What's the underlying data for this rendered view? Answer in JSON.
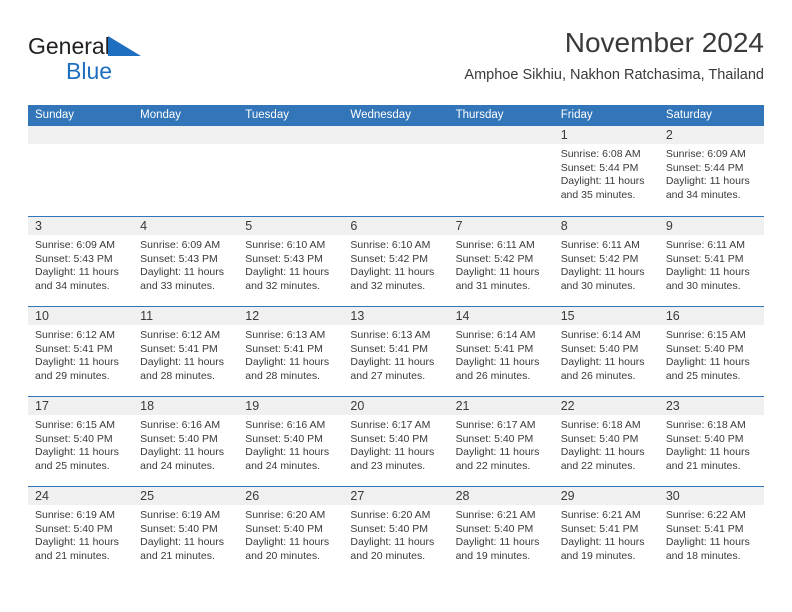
{
  "brand": {
    "name_part1": "General",
    "name_part2": "Blue",
    "flag_icon": "triangle-flag-icon"
  },
  "header": {
    "title": "November 2024",
    "subtitle": "Amphoe Sikhiu, Nakhon Ratchasima, Thailand"
  },
  "colors": {
    "header_blue": "#3275b8",
    "brand_blue": "#1f6fc0",
    "day_band_gray": "#f0f0f0",
    "text": "#3a3a3a"
  },
  "weekdays": [
    "Sunday",
    "Monday",
    "Tuesday",
    "Wednesday",
    "Thursday",
    "Friday",
    "Saturday"
  ],
  "weeks": [
    [
      {
        "day": "",
        "empty": true
      },
      {
        "day": "",
        "empty": true
      },
      {
        "day": "",
        "empty": true
      },
      {
        "day": "",
        "empty": true
      },
      {
        "day": "",
        "empty": true
      },
      {
        "day": "1",
        "sunrise": "Sunrise: 6:08 AM",
        "sunset": "Sunset: 5:44 PM",
        "daylight": "Daylight: 11 hours and 35 minutes."
      },
      {
        "day": "2",
        "sunrise": "Sunrise: 6:09 AM",
        "sunset": "Sunset: 5:44 PM",
        "daylight": "Daylight: 11 hours and 34 minutes."
      }
    ],
    [
      {
        "day": "3",
        "sunrise": "Sunrise: 6:09 AM",
        "sunset": "Sunset: 5:43 PM",
        "daylight": "Daylight: 11 hours and 34 minutes."
      },
      {
        "day": "4",
        "sunrise": "Sunrise: 6:09 AM",
        "sunset": "Sunset: 5:43 PM",
        "daylight": "Daylight: 11 hours and 33 minutes."
      },
      {
        "day": "5",
        "sunrise": "Sunrise: 6:10 AM",
        "sunset": "Sunset: 5:43 PM",
        "daylight": "Daylight: 11 hours and 32 minutes."
      },
      {
        "day": "6",
        "sunrise": "Sunrise: 6:10 AM",
        "sunset": "Sunset: 5:42 PM",
        "daylight": "Daylight: 11 hours and 32 minutes."
      },
      {
        "day": "7",
        "sunrise": "Sunrise: 6:11 AM",
        "sunset": "Sunset: 5:42 PM",
        "daylight": "Daylight: 11 hours and 31 minutes."
      },
      {
        "day": "8",
        "sunrise": "Sunrise: 6:11 AM",
        "sunset": "Sunset: 5:42 PM",
        "daylight": "Daylight: 11 hours and 30 minutes."
      },
      {
        "day": "9",
        "sunrise": "Sunrise: 6:11 AM",
        "sunset": "Sunset: 5:41 PM",
        "daylight": "Daylight: 11 hours and 30 minutes."
      }
    ],
    [
      {
        "day": "10",
        "sunrise": "Sunrise: 6:12 AM",
        "sunset": "Sunset: 5:41 PM",
        "daylight": "Daylight: 11 hours and 29 minutes."
      },
      {
        "day": "11",
        "sunrise": "Sunrise: 6:12 AM",
        "sunset": "Sunset: 5:41 PM",
        "daylight": "Daylight: 11 hours and 28 minutes."
      },
      {
        "day": "12",
        "sunrise": "Sunrise: 6:13 AM",
        "sunset": "Sunset: 5:41 PM",
        "daylight": "Daylight: 11 hours and 28 minutes."
      },
      {
        "day": "13",
        "sunrise": "Sunrise: 6:13 AM",
        "sunset": "Sunset: 5:41 PM",
        "daylight": "Daylight: 11 hours and 27 minutes."
      },
      {
        "day": "14",
        "sunrise": "Sunrise: 6:14 AM",
        "sunset": "Sunset: 5:41 PM",
        "daylight": "Daylight: 11 hours and 26 minutes."
      },
      {
        "day": "15",
        "sunrise": "Sunrise: 6:14 AM",
        "sunset": "Sunset: 5:40 PM",
        "daylight": "Daylight: 11 hours and 26 minutes."
      },
      {
        "day": "16",
        "sunrise": "Sunrise: 6:15 AM",
        "sunset": "Sunset: 5:40 PM",
        "daylight": "Daylight: 11 hours and 25 minutes."
      }
    ],
    [
      {
        "day": "17",
        "sunrise": "Sunrise: 6:15 AM",
        "sunset": "Sunset: 5:40 PM",
        "daylight": "Daylight: 11 hours and 25 minutes."
      },
      {
        "day": "18",
        "sunrise": "Sunrise: 6:16 AM",
        "sunset": "Sunset: 5:40 PM",
        "daylight": "Daylight: 11 hours and 24 minutes."
      },
      {
        "day": "19",
        "sunrise": "Sunrise: 6:16 AM",
        "sunset": "Sunset: 5:40 PM",
        "daylight": "Daylight: 11 hours and 24 minutes."
      },
      {
        "day": "20",
        "sunrise": "Sunrise: 6:17 AM",
        "sunset": "Sunset: 5:40 PM",
        "daylight": "Daylight: 11 hours and 23 minutes."
      },
      {
        "day": "21",
        "sunrise": "Sunrise: 6:17 AM",
        "sunset": "Sunset: 5:40 PM",
        "daylight": "Daylight: 11 hours and 22 minutes."
      },
      {
        "day": "22",
        "sunrise": "Sunrise: 6:18 AM",
        "sunset": "Sunset: 5:40 PM",
        "daylight": "Daylight: 11 hours and 22 minutes."
      },
      {
        "day": "23",
        "sunrise": "Sunrise: 6:18 AM",
        "sunset": "Sunset: 5:40 PM",
        "daylight": "Daylight: 11 hours and 21 minutes."
      }
    ],
    [
      {
        "day": "24",
        "sunrise": "Sunrise: 6:19 AM",
        "sunset": "Sunset: 5:40 PM",
        "daylight": "Daylight: 11 hours and 21 minutes."
      },
      {
        "day": "25",
        "sunrise": "Sunrise: 6:19 AM",
        "sunset": "Sunset: 5:40 PM",
        "daylight": "Daylight: 11 hours and 21 minutes."
      },
      {
        "day": "26",
        "sunrise": "Sunrise: 6:20 AM",
        "sunset": "Sunset: 5:40 PM",
        "daylight": "Daylight: 11 hours and 20 minutes."
      },
      {
        "day": "27",
        "sunrise": "Sunrise: 6:20 AM",
        "sunset": "Sunset: 5:40 PM",
        "daylight": "Daylight: 11 hours and 20 minutes."
      },
      {
        "day": "28",
        "sunrise": "Sunrise: 6:21 AM",
        "sunset": "Sunset: 5:40 PM",
        "daylight": "Daylight: 11 hours and 19 minutes."
      },
      {
        "day": "29",
        "sunrise": "Sunrise: 6:21 AM",
        "sunset": "Sunset: 5:41 PM",
        "daylight": "Daylight: 11 hours and 19 minutes."
      },
      {
        "day": "30",
        "sunrise": "Sunrise: 6:22 AM",
        "sunset": "Sunset: 5:41 PM",
        "daylight": "Daylight: 11 hours and 18 minutes."
      }
    ]
  ]
}
